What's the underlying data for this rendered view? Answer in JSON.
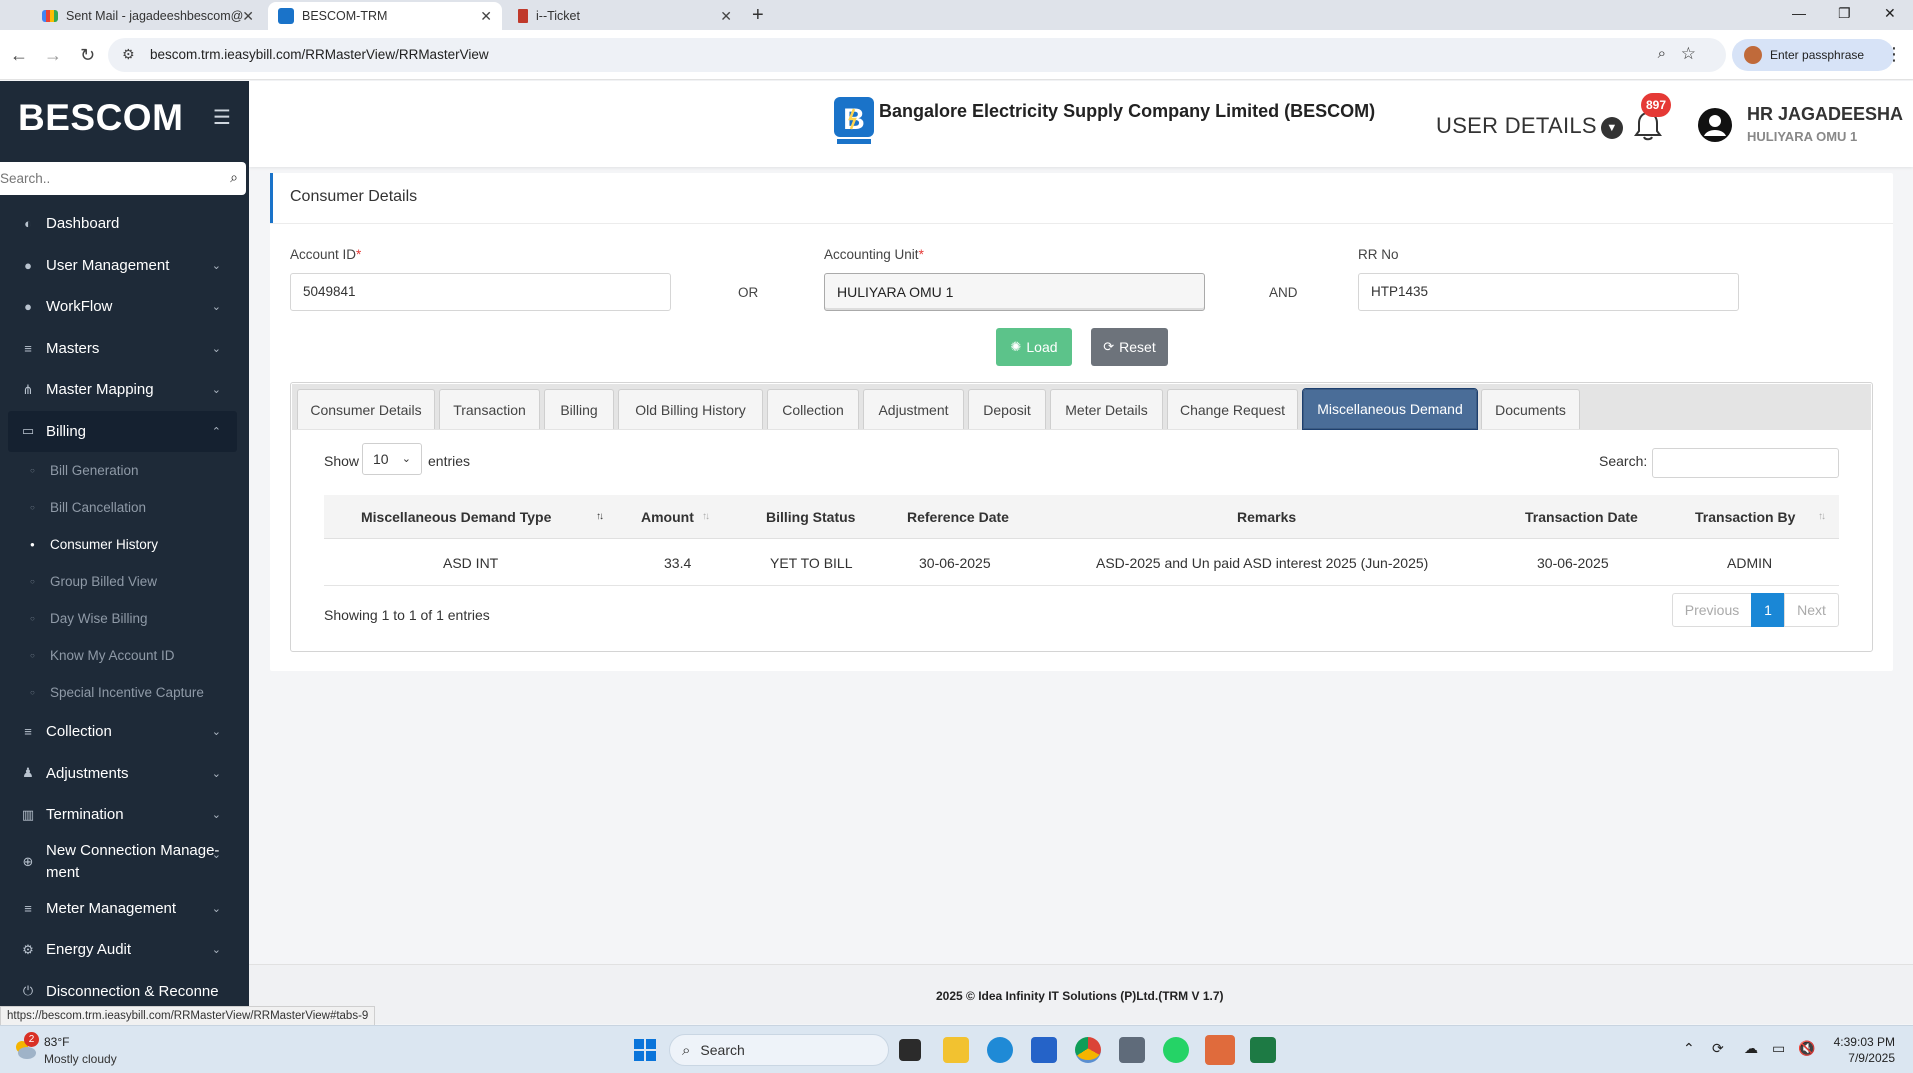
{
  "browser": {
    "tabs": [
      {
        "title": "Sent Mail - jagadeeshbescom@"
      },
      {
        "title": "BESCOM-TRM"
      },
      {
        "title": "i--Ticket"
      }
    ],
    "url": "bescom.trm.ieasybill.com/RRMasterView/RRMasterView",
    "profile_label": "Enter passphrase"
  },
  "sidebar": {
    "brand": "BESCOM",
    "search_placeholder": "Search..",
    "menu": [
      {
        "label": "Dashboard",
        "icon": "palette-icon"
      },
      {
        "label": "User Management",
        "icon": "user-icon"
      },
      {
        "label": "WorkFlow",
        "icon": "user-icon"
      },
      {
        "label": "Masters",
        "icon": "list-icon"
      },
      {
        "label": "Master Mapping",
        "icon": "sitemap-icon"
      },
      {
        "label": "Billing",
        "icon": "monitor-icon"
      }
    ],
    "billing_sub": [
      "Bill Generation",
      "Bill Cancellation",
      "Consumer History",
      "Group Billed View",
      "Day Wise Billing",
      "Know My Account ID",
      "Special Incentive Capture"
    ],
    "menu_after": [
      {
        "label": "Collection",
        "icon": "list-icon"
      },
      {
        "label": "Adjustments",
        "icon": "users-icon"
      },
      {
        "label": "Termination",
        "icon": "trash-icon"
      },
      {
        "label": "New Connection Manage-ment",
        "icon": "plus-circle-icon"
      },
      {
        "label": "Meter Management",
        "icon": "list-icon"
      },
      {
        "label": "Energy Audit",
        "icon": "gears-icon"
      },
      {
        "label": "Disconnection & Reconne",
        "icon": "plug-icon"
      }
    ]
  },
  "header": {
    "company": "Bangalore Electricity Supply Company Limited (BESCOM)",
    "user_details": "USER DETAILS",
    "notification_count": "897",
    "user_name": "HR JAGADEESHA",
    "user_role": "HULIYARA OMU 1"
  },
  "consumer": {
    "title": "Consumer Details",
    "account_id_label": "Account ID",
    "account_id_value": "5049841",
    "or_label": "OR",
    "accounting_unit_label": "Accounting Unit",
    "accounting_unit_value": "HULIYARA OMU 1",
    "and_label": "AND",
    "rr_no_label": "RR No",
    "rr_no_value": "HTP1435",
    "load_label": "Load",
    "reset_label": "Reset"
  },
  "tabs": [
    "Consumer Details",
    "Transaction",
    "Billing",
    "Old Billing History",
    "Collection",
    "Adjustment",
    "Deposit",
    "Meter Details",
    "Change Request",
    "Miscellaneous Demand",
    "Documents"
  ],
  "table": {
    "show_label": "Show",
    "page_size": "10",
    "entries_label": "entries",
    "search_label": "Search:",
    "columns": [
      "Miscellaneous Demand Type",
      "Amount",
      "Billing Status",
      "Reference Date",
      "Remarks",
      "Transaction Date",
      "Transaction By"
    ],
    "rows": [
      [
        "ASD INT",
        "33.4",
        "YET TO BILL",
        "30-06-2025",
        "ASD-2025 and Un paid ASD interest 2025 (Jun-2025)",
        "30-06-2025",
        "ADMIN"
      ]
    ],
    "info": "Showing 1 to 1 of 1 entries",
    "prev_label": "Previous",
    "current_page": "1",
    "next_label": "Next"
  },
  "footer": "2025 © Idea Infinity IT Solutions (P)Ltd.(TRM V 1.7)",
  "status_url": "https://bescom.trm.ieasybill.com/RRMasterView/RRMasterView#tabs-9",
  "taskbar": {
    "weather_temp": "83°F",
    "weather_desc": "Mostly cloudy",
    "weather_badge": "2",
    "search_label": "Search",
    "time": "4:39:03 PM",
    "date": "7/9/2025"
  }
}
